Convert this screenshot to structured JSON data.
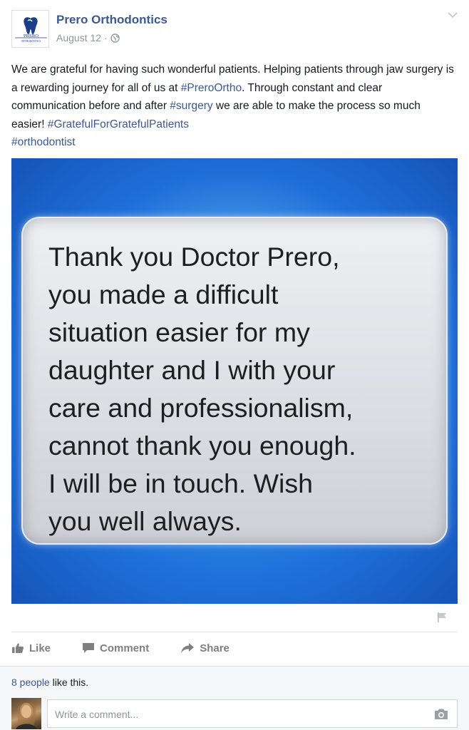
{
  "page": {
    "name": "Prero Orthodontics",
    "date": "August 12 ·",
    "logo_text": "PRERO",
    "logo_subtext": "ORTHODONTICS"
  },
  "post": {
    "text_parts": {
      "p1": "We are grateful for having such wonderful patients. Helping patients through jaw surgery is a rewarding journey for all of us at ",
      "tag1": "#PreroOrtho",
      "p2": ". Through constant and clear communication before and after ",
      "tag2": "#surgery",
      "p3": " we are able to make the process so much easier! ",
      "tag3": "#GratefulForGratefulPatients",
      "tag4": "#orthodontist"
    },
    "image_text": "Thank you Doctor Prero,\nyou made a difficult\nsituation easier for my\ndaughter and I with your\ncare and professionalism,\ncannot thank you enough.\nI will be in touch. Wish\nyou well always."
  },
  "actions": {
    "like": "Like",
    "comment": "Comment",
    "share": "Share"
  },
  "footer": {
    "people_count": "8 people",
    "likes_suffix": " like this.",
    "comment_placeholder": "Write a comment..."
  },
  "icons": {
    "globe": "globe-icon",
    "chevron": "chevron-down-icon",
    "flag": "flag-icon",
    "like": "thumbs-up-icon",
    "comment": "comment-bubble-icon",
    "share": "share-arrow-icon",
    "camera": "camera-icon"
  },
  "colors": {
    "link": "#3b5998",
    "muted": "#90949c",
    "action": "#7f7f7f",
    "image_blue": "#1e6fd9"
  }
}
